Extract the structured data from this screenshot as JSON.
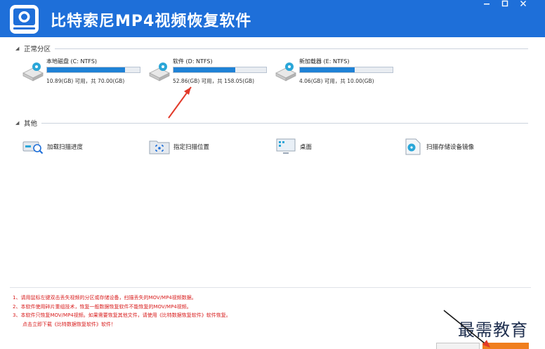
{
  "window": {
    "title": "比特索尼MP4视频恢复软件",
    "controls": [
      "minimize",
      "maximize",
      "close"
    ]
  },
  "partitions_section": {
    "title": "正常分区",
    "drives": [
      {
        "name": "本地磁盘 (C: NTFS)",
        "info": "10.89(GB) 可用，共 70.00(GB)",
        "used_fraction": 0.84
      },
      {
        "name": "软件 (D: NTFS)",
        "info": "52.86(GB) 可用，共 158.05(GB)",
        "used_fraction": 0.67
      },
      {
        "name": "新加载器 (E: NTFS)",
        "info": "4.06(GB) 可用，共 10.00(GB)",
        "used_fraction": 0.59
      }
    ]
  },
  "other_section": {
    "title": "其他",
    "items": [
      {
        "label": "加载扫描进度",
        "icon": "load-scan-progress-icon"
      },
      {
        "label": "指定扫描位置",
        "icon": "scan-location-icon"
      },
      {
        "label": "桌面",
        "icon": "desktop-icon"
      },
      {
        "label": "扫描存储设备镜像",
        "icon": "disk-image-icon"
      }
    ]
  },
  "notes": [
    "1、请用鼠标左键双击丢失视频的分区或存储设备，扫描丢失的MOV/MP4视频数据。",
    "2、本软件使用碎片重组技术，恢复一般数据恢复软件不能恢复的MOV/MP4视频。",
    "3、本软件只恢复MOV/MP4视频。如果需要恢复其他文件，请使用《比特数据恢复软件》软件恢复。",
    "点击立即下载《比特数据恢复软件》软件！"
  ],
  "watermark": "最需教育",
  "colors": {
    "title_bar": "#1e6fd9",
    "progress_fill": "#1f82d6",
    "note_text": "#d81b1b",
    "annotation_arrow": "#e23a2a",
    "primary_button": "#f07e1d"
  }
}
